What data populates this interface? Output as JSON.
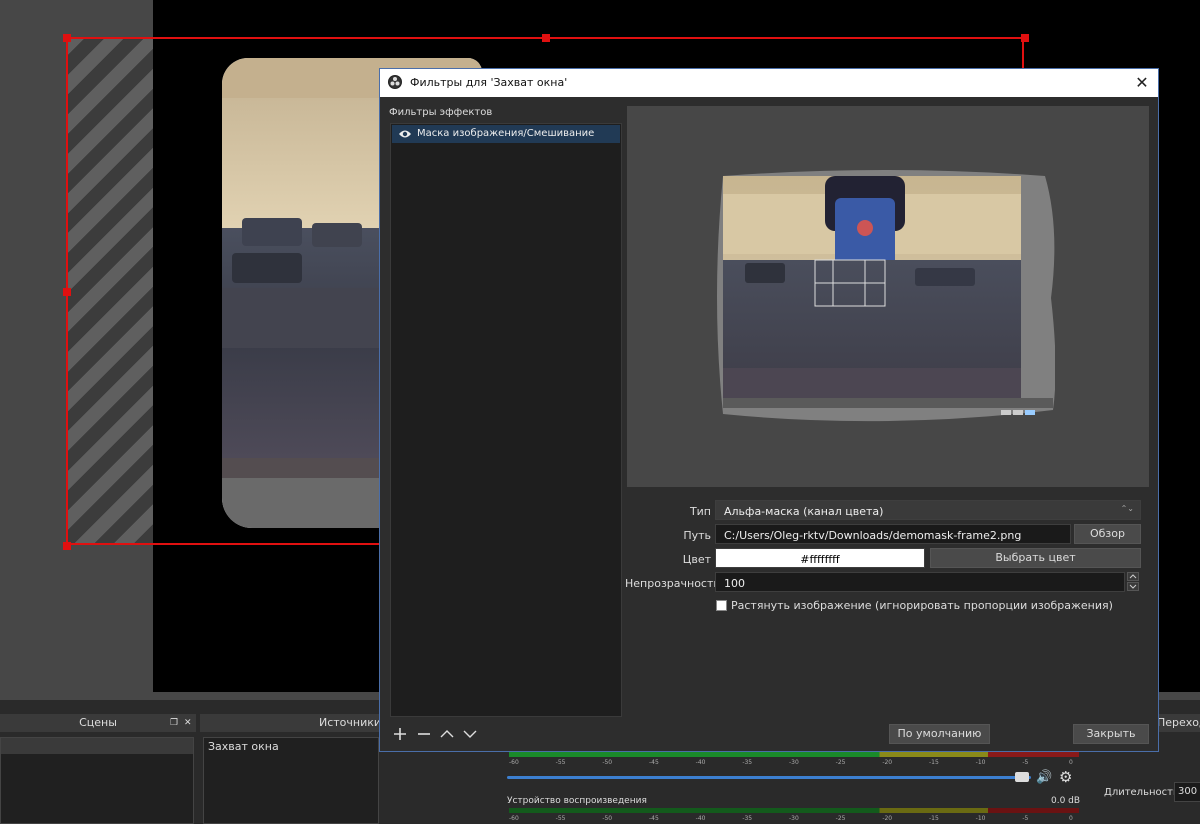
{
  "dialog": {
    "title": "Фильтры для 'Захват окна'",
    "effects_label": "Фильтры эффектов",
    "filters": [
      {
        "name": "Маска изображения/Смешивание",
        "visible": true
      }
    ],
    "toolbar": {
      "add": "+",
      "remove": "—",
      "move_up": "∧",
      "move_down": "∨"
    },
    "form": {
      "type_label": "Тип",
      "type_value": "Альфа-маска (канал цвета)",
      "path_label": "Путь",
      "path_value": "C:/Users/Oleg-rktv/Downloads/demomask-frame2.png",
      "browse_button": "Обзор",
      "color_label": "Цвет",
      "color_value": "#ffffffff",
      "pick_color_button": "Выбрать цвет",
      "opacity_label": "Непрозрачность",
      "opacity_value": "100",
      "stretch_checkbox": "Растянуть изображение (игнорировать пропорции изображения)",
      "stretch_checked": false
    },
    "defaults_button": "По умолчанию",
    "close_button": "Закрыть",
    "close_icon": "✕"
  },
  "main": {
    "docks": {
      "scenes_title": "Сцены",
      "sources_title": "Источники",
      "transitions_title": "Переходы"
    },
    "sources": [
      "Захват окна"
    ],
    "mixer": {
      "device_label": "Устройство воспроизведения",
      "device_level": "0.0 dB",
      "ticks": [
        "-60",
        "-55",
        "-50",
        "-45",
        "-40",
        "-35",
        "-30",
        "-25",
        "-20",
        "-15",
        "-10",
        "-5",
        "0"
      ],
      "volume_fraction": 0.98
    },
    "transitions": {
      "duration_label": "Длительность",
      "duration_value": "300"
    }
  },
  "colors": {
    "accent_selection": "#e01010",
    "dialog_border": "#4a6ea9",
    "list_selected": "#213a55",
    "volume_bar": "#3c7fd0"
  }
}
